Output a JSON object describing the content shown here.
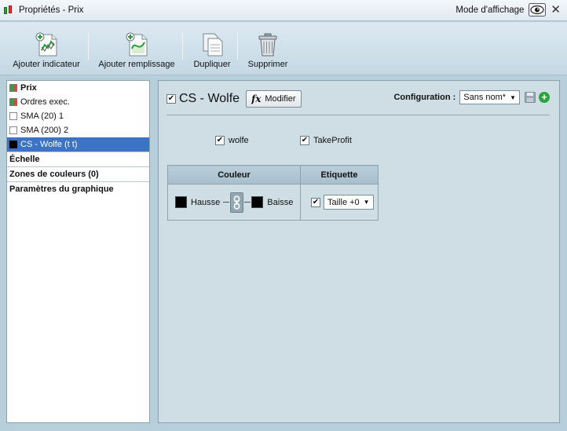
{
  "window": {
    "title": "Propriétés - Prix",
    "mode_label": "Mode d'affichage"
  },
  "toolbar": {
    "add_indicator": "Ajouter indicateur",
    "add_fill": "Ajouter remplissage",
    "duplicate": "Dupliquer",
    "delete": "Supprimer"
  },
  "tree": {
    "items": [
      {
        "label": "Prix",
        "swatch": "pg",
        "bold": true,
        "selected": false
      },
      {
        "label": "Ordres exec.",
        "swatch": "pg",
        "bold": false,
        "selected": false
      },
      {
        "label": "SMA (20) 1",
        "swatch": "empty",
        "bold": false,
        "selected": false
      },
      {
        "label": "SMA (200) 2",
        "swatch": "empty",
        "bold": false,
        "selected": false
      },
      {
        "label": "CS - Wolfe (t t)",
        "swatch": "black",
        "bold": false,
        "selected": true
      }
    ],
    "sections": [
      "Échelle",
      "Zones de couleurs (0)",
      "Paramètres du graphique"
    ]
  },
  "indicator": {
    "name": "CS - Wolfe",
    "enabled": true,
    "modify_label": "Modifier",
    "fx_symbol": "fx"
  },
  "config": {
    "label": "Configuration :",
    "value": "Sans nom*"
  },
  "options": {
    "wolfe_label": "wolfe",
    "wolfe_checked": true,
    "takeprofit_label": "TakeProfit",
    "takeprofit_checked": true
  },
  "colors_table": {
    "col_color": "Couleur",
    "col_label": "Etiquette",
    "up_label": "Hausse",
    "down_label": "Baisse",
    "up_color": "#000000",
    "down_color": "#000000",
    "label_checked": true,
    "size_value": "Taille +0"
  },
  "theme": {
    "selection": "#3d73c4",
    "add_green": "#2ba33b"
  }
}
